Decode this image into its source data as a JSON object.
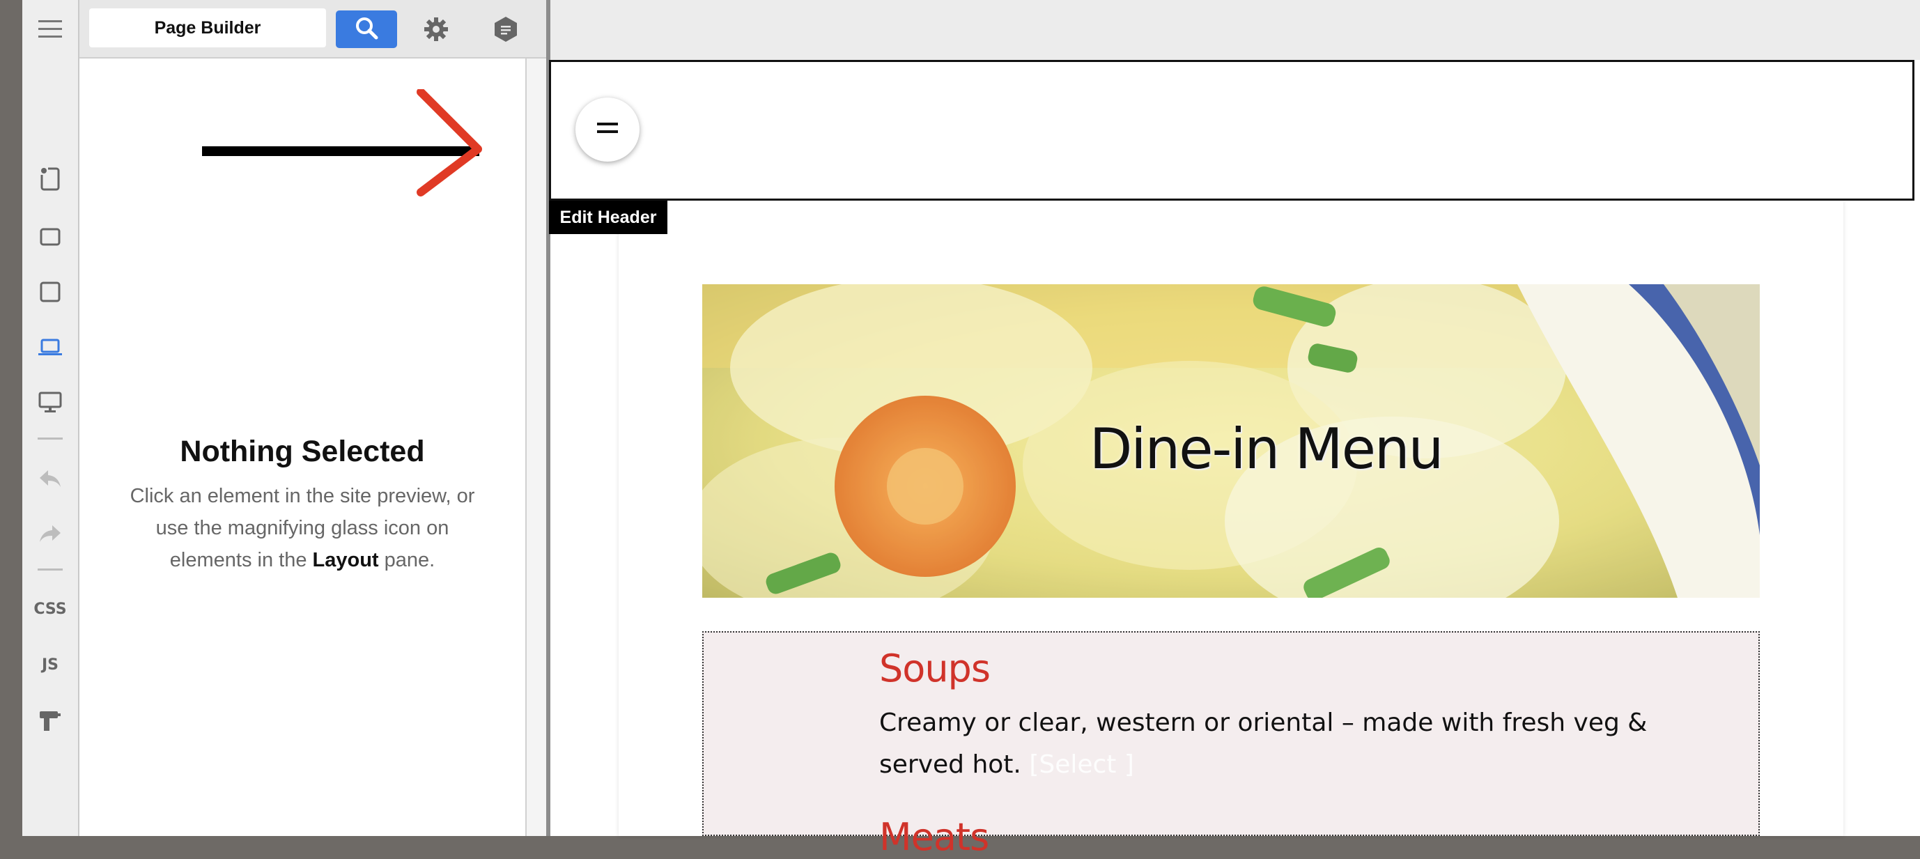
{
  "toolbar": {
    "title": "Page Builder",
    "search_icon": "magnifying-glass-icon",
    "settings_icon": "gear-icon",
    "notes_icon": "hexagon-note-icon",
    "accent_color": "#3a7be0"
  },
  "rail": {
    "menu_icon": "hamburger-menu-icon",
    "devices": [
      "phone-portrait-icon",
      "phone-landscape-icon",
      "tablet-icon",
      "laptop-icon",
      "desktop-icon"
    ],
    "active_device": "laptop-icon",
    "undo_icon": "undo-icon",
    "redo_icon": "redo-icon",
    "css_label": "CSS",
    "js_label": "JS",
    "tools_icon": "hammer-icon"
  },
  "panel": {
    "empty_title": "Nothing Selected",
    "empty_line1": "Click an element in the site preview, or use the magnifying glass icon on elements in the ",
    "empty_bold": "Layout",
    "empty_line2": " pane."
  },
  "preview": {
    "header_menu_icon": "equals-menu-icon",
    "edit_header_label": "Edit Header",
    "hero_title": "Dine-in Menu",
    "sections": [
      {
        "title": "Soups",
        "description": "Creamy or clear, western or oriental – made with fresh veg & served hot.",
        "select_tag": "[Select ]"
      },
      {
        "title": "Meats"
      }
    ],
    "section_title_color": "#d0332a"
  }
}
